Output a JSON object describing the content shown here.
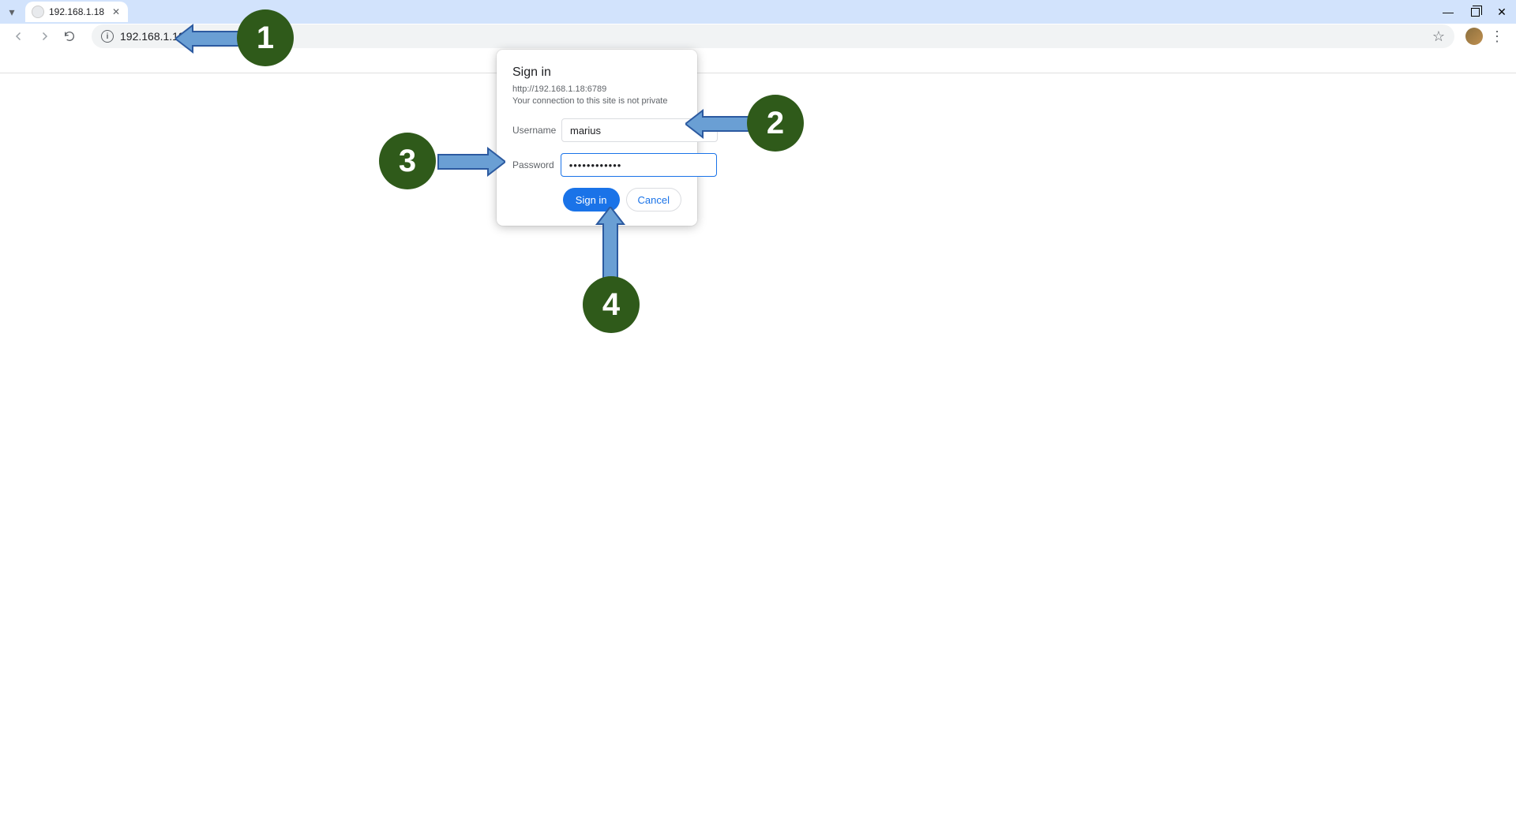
{
  "browser": {
    "tab_title": "192.168.1.18",
    "url_host": "192.168.1.18",
    "url_port": ":6789"
  },
  "dialog": {
    "title": "Sign in",
    "url": "http://192.168.1.18:6789",
    "warning": "Your connection to this site is not private",
    "username_label": "Username",
    "username_value": "marius",
    "password_label": "Password",
    "password_value": "••••••••••••",
    "signin_label": "Sign in",
    "cancel_label": "Cancel"
  },
  "annotations": {
    "b1": "1",
    "b2": "2",
    "b3": "3",
    "b4": "4"
  }
}
